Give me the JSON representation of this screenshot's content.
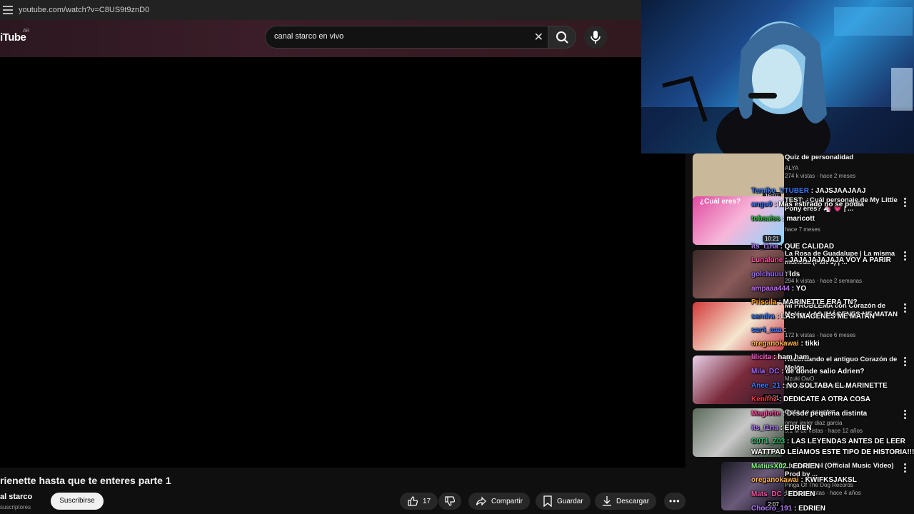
{
  "browser": {
    "url": "youtube.com/watch?v=C8US9t9znD0"
  },
  "header": {
    "logo": "iTube",
    "country": "AR",
    "search_value": "canal starco en vivo"
  },
  "video": {
    "title": "rienette hasta que te enteres parte 1",
    "channel": "al starco",
    "subscribers": "suscriptores",
    "subscribe_label": "Suscribirse",
    "likes": "17",
    "share_label": "Compartir",
    "save_label": "Guardar",
    "download_label": "Descargar"
  },
  "sidebar": {
    "items": [
      {
        "title": "Quiz de personalidad",
        "channel": "ALYA",
        "views": "274 k vistas · hace 2 meses",
        "duration": "16:07",
        "thumb": "#c9b89a"
      },
      {
        "title": "TEST: ¿Cuál personaje de My Little Pony eres? 🦄 💗 | ...",
        "channel": "",
        "views": "hace 7 meses",
        "duration": "10:21",
        "thumb": "#e04aa0",
        "banner": "¿Cuál eres?"
      },
      {
        "title": "La Rosa de Guadalupe | La misma moneda (Part 1) | ...",
        "channel": "Vlogs",
        "views": "294 k vistas · hace 2 semanas",
        "duration": "",
        "thumb": "#5a3a3a"
      },
      {
        "title": "Mi PROBLEMA con Corazón de Melón: LAS IMÁGENES ME MATAN",
        "channel": "",
        "views": "172 k vistas · hace 6 meses",
        "duration": "",
        "thumb": "#d23a3a"
      },
      {
        "title": "Recordando el antiguo Corazón de Melón",
        "channel": "Mzuki OwO",
        "views": "17 k vistas · hace 8 meses",
        "duration": "12:21",
        "thumb": "#7a2a3a"
      },
      {
        "title": "Gata se asusta",
        "channel": "omar javier diaz garcia",
        "views": "5.1 M de vistas · hace 12 años",
        "duration": "",
        "thumb": "#3c4a3c"
      },
      {
        "title": "Lluvia Y Sol (Official Music Video) Prod by ...",
        "channel": "Pinga Of The Dog Records",
        "views": "123 M de vistas · hace 4 años",
        "duration": "2:07",
        "thumb": "#2a2a34"
      }
    ]
  },
  "chat": [
    {
      "user": "Tamiko_VTUBER",
      "text": ": JAJSJAAJAAJ",
      "color": "#3a7bff"
    },
    {
      "user": "angu0",
      "text": ": Más estirado no se podía",
      "color": "#3a7bff"
    },
    {
      "user": "tobaaiss",
      "text": ": maricott",
      "color": "#2ecc40"
    },
    {
      "user": "its_t1na",
      "text": ": QUE CALIDAD",
      "color": "#b57bff"
    },
    {
      "user": "Lunalune",
      "text": ": JAJAJAJAJAJA VOY A PARIR",
      "color": "#ff4fa0"
    },
    {
      "user": "golchuuu",
      "text": ": lds",
      "color": "#9a6bff"
    },
    {
      "user": "ampaaa444",
      "text": ": YO",
      "color": "#c06bff"
    },
    {
      "user": "Priscila",
      "text": ": MARINETTE ERA TN?",
      "color": "#ff9f1a"
    },
    {
      "user": "sandra",
      "text": ": LAS IMAGENES ME MATAN",
      "color": "#3a7bff"
    },
    {
      "user": "sar4_aaa",
      "text": ":",
      "color": "#3a7bff"
    },
    {
      "user": "oreganokawai",
      "text": ": tikki",
      "color": "#ffb347"
    },
    {
      "user": "lilicita",
      "text": ": ham ham",
      "color": "#ff5ad2"
    },
    {
      "user": "Mila_DC",
      "text": ": de donde salio Adrien?",
      "color": "#a06bff"
    },
    {
      "user": "Anee_21",
      "text": ": NO SOLTABA EL MARINETTE",
      "color": "#3a7bff"
    },
    {
      "user": "Kenifnz",
      "text": ": DEDICATE A OTRA COSA",
      "color": "#ff3a3a"
    },
    {
      "user": "Maglotte",
      "text": ": Desde pequeña distinta",
      "color": "#ff4fa0"
    },
    {
      "user": "its_t1na",
      "text": ": EDRIEN",
      "color": "#b57bff"
    },
    {
      "user": "C0T1_Z03",
      "text": ": LAS LEYENDAS ANTES DE LEER",
      "color": "#2ecc71"
    },
    {
      "user": "",
      "text": "WATTPAD LEÍAMOS ESTE TIPO DE HISTORIA!!!",
      "color": "#fff"
    },
    {
      "user": "MatiusX02",
      "text": ": EDRIEN",
      "color": "#7dff7d"
    },
    {
      "user": "oreganokawai",
      "text": ": KWIFKSJAKSL",
      "color": "#ffb347"
    },
    {
      "user": "Mats_DC",
      "text": ": EDRIEN",
      "color": "#ff4fa0"
    },
    {
      "user": "Chocro_191",
      "text": ": EDRIEN",
      "color": "#b57bff"
    }
  ]
}
